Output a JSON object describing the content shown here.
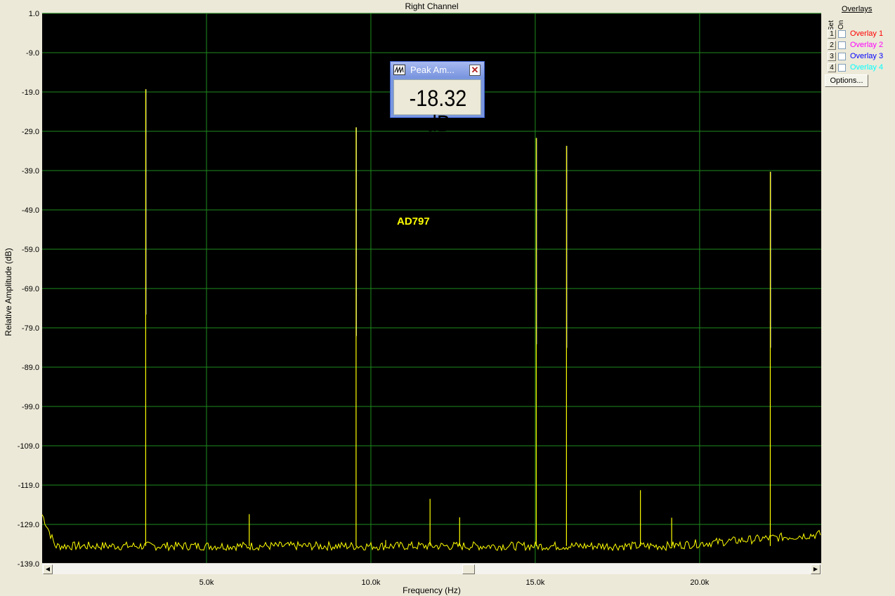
{
  "window": {
    "title": "Right Channel",
    "annotation": "AD797"
  },
  "colors": {
    "plot_bg": "#000000",
    "grid": "#1e8c1e",
    "trace": "#ffff00",
    "trace_dim": "#ffffff"
  },
  "peak_window": {
    "title": "Peak Am...",
    "value": "-18.32 dB",
    "icon": "waveform-icon",
    "close_icon": "close-icon"
  },
  "overlays": {
    "title": "Overlays",
    "set_label": "Set",
    "on_label": "On",
    "items": [
      {
        "num": "1",
        "label": "Overlay 1",
        "color": "#ff0000",
        "checked": false
      },
      {
        "num": "2",
        "label": "Overlay 2",
        "color": "#ff00ff",
        "checked": false
      },
      {
        "num": "3",
        "label": "Overlay 3",
        "color": "#0000ff",
        "checked": false
      },
      {
        "num": "4",
        "label": "Overlay 4",
        "color": "#00ffff",
        "checked": false
      }
    ],
    "options_label": "Options..."
  },
  "chart_data": {
    "type": "line",
    "title": "Right Channel",
    "xlabel": "Frequency (Hz)",
    "ylabel": "Relative Amplitude (dB)",
    "xlim": [
      0,
      23700
    ],
    "ylim": [
      -139,
      1
    ],
    "grid": true,
    "yticks": [
      "1.0",
      "-9.0",
      "-19.0",
      "-29.0",
      "-39.0",
      "-49.0",
      "-59.0",
      "-69.0",
      "-79.0",
      "-89.0",
      "-99.0",
      "-109.0",
      "-119.0",
      "-129.0",
      "-139.0"
    ],
    "xticks": [
      {
        "value": 5000,
        "label": "5.0k"
      },
      {
        "value": 10000,
        "label": "10.0k"
      },
      {
        "value": 15000,
        "label": "15.0k"
      },
      {
        "value": 20000,
        "label": "20.0k"
      }
    ],
    "noise_floor": -134.5,
    "series": [
      {
        "peaks": [
          {
            "x": 3150,
            "y": -18.3,
            "dim": -75.6
          },
          {
            "x": 6300,
            "y": -126.4
          },
          {
            "x": 9550,
            "y": -28.0,
            "dim": -81.1
          },
          {
            "x": 10450,
            "y": -133.0
          },
          {
            "x": 11800,
            "y": -122.5
          },
          {
            "x": 12700,
            "y": -127.2
          },
          {
            "x": 15030,
            "y": -30.7,
            "dim": -83.2
          },
          {
            "x": 15950,
            "y": -32.7,
            "dim": -84.1
          },
          {
            "x": 18200,
            "y": -120.3
          },
          {
            "x": 19150,
            "y": -127.3
          },
          {
            "x": 22150,
            "y": -39.3,
            "dim": -84.1
          }
        ]
      }
    ]
  }
}
